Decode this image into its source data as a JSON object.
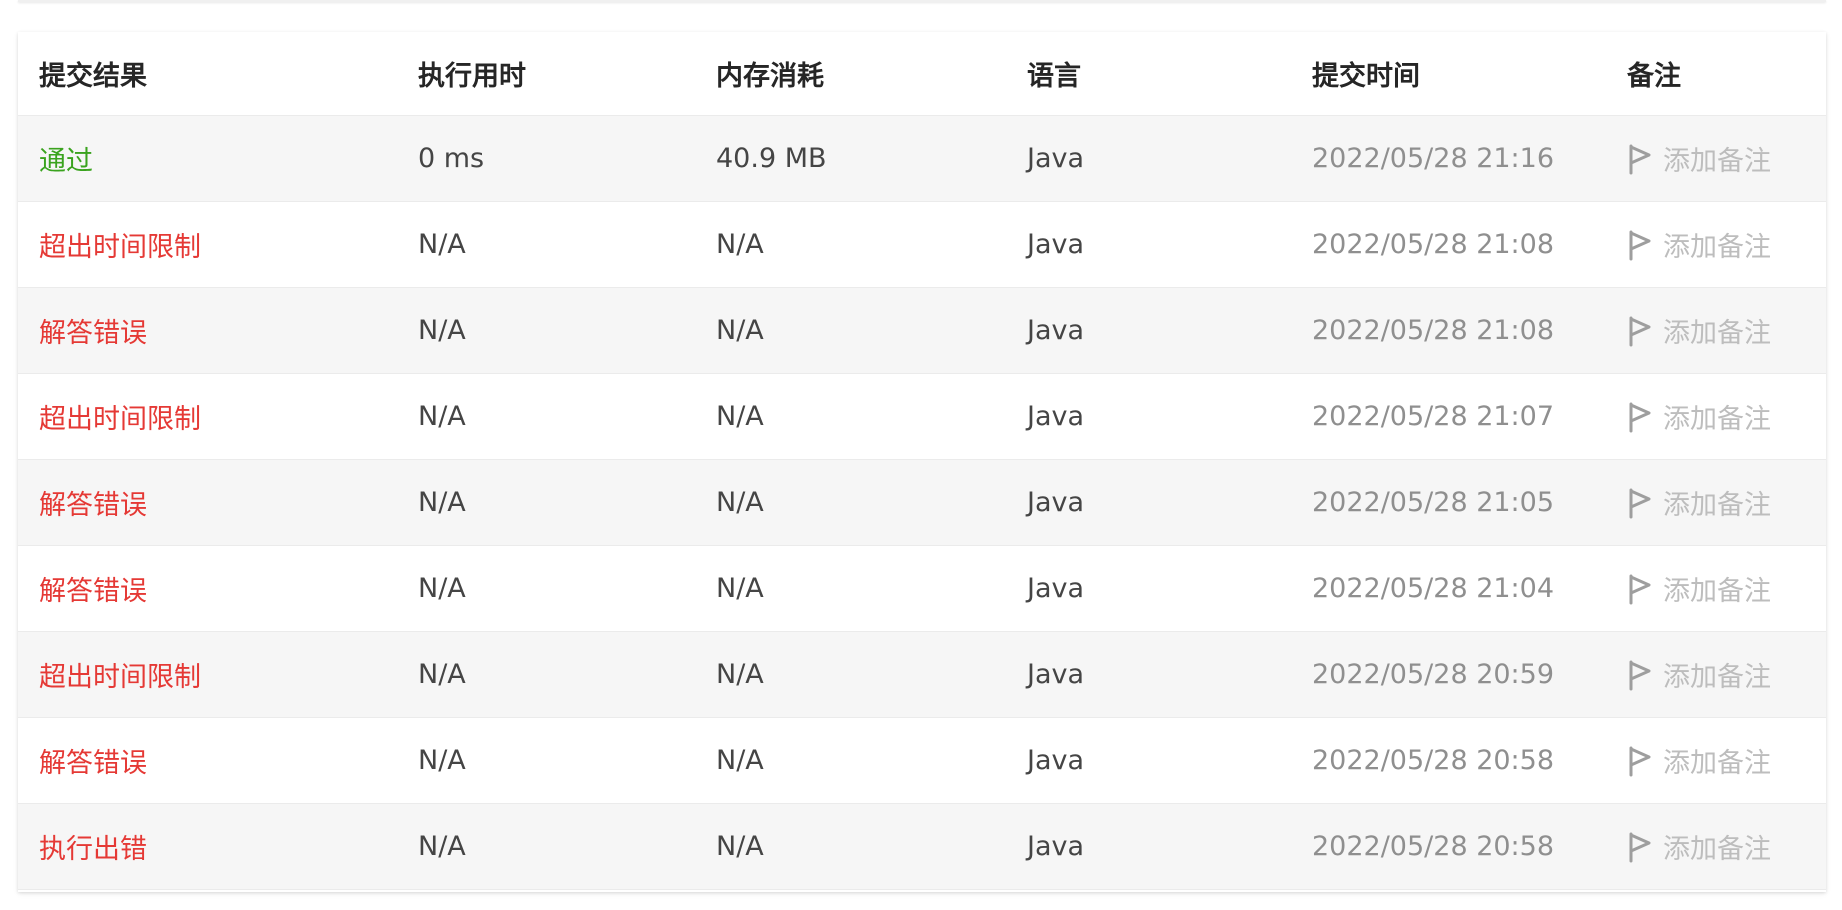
{
  "header": {
    "status": "提交结果",
    "runtime": "执行用时",
    "memory": "内存消耗",
    "language": "语言",
    "submitted": "提交时间",
    "note": "备注"
  },
  "colors": {
    "accepted": "#3aa31e",
    "error": "#e53935",
    "alt_row": "#f6f6f6"
  },
  "note_icon": "flag-icon",
  "rows": [
    {
      "status": "通过",
      "kind": "accepted",
      "runtime": "0 ms",
      "memory": "40.9 MB",
      "language": "Java",
      "time": "2022/05/28 21:16",
      "note": "添加备注"
    },
    {
      "status": "超出时间限制",
      "kind": "error",
      "runtime": "N/A",
      "memory": "N/A",
      "language": "Java",
      "time": "2022/05/28 21:08",
      "note": "添加备注"
    },
    {
      "status": "解答错误",
      "kind": "error",
      "runtime": "N/A",
      "memory": "N/A",
      "language": "Java",
      "time": "2022/05/28 21:08",
      "note": "添加备注"
    },
    {
      "status": "超出时间限制",
      "kind": "error",
      "runtime": "N/A",
      "memory": "N/A",
      "language": "Java",
      "time": "2022/05/28 21:07",
      "note": "添加备注"
    },
    {
      "status": "解答错误",
      "kind": "error",
      "runtime": "N/A",
      "memory": "N/A",
      "language": "Java",
      "time": "2022/05/28 21:05",
      "note": "添加备注"
    },
    {
      "status": "解答错误",
      "kind": "error",
      "runtime": "N/A",
      "memory": "N/A",
      "language": "Java",
      "time": "2022/05/28 21:04",
      "note": "添加备注"
    },
    {
      "status": "超出时间限制",
      "kind": "error",
      "runtime": "N/A",
      "memory": "N/A",
      "language": "Java",
      "time": "2022/05/28 20:59",
      "note": "添加备注"
    },
    {
      "status": "解答错误",
      "kind": "error",
      "runtime": "N/A",
      "memory": "N/A",
      "language": "Java",
      "time": "2022/05/28 20:58",
      "note": "添加备注"
    },
    {
      "status": "执行出错",
      "kind": "error",
      "runtime": "N/A",
      "memory": "N/A",
      "language": "Java",
      "time": "2022/05/28 20:58",
      "note": "添加备注"
    }
  ]
}
